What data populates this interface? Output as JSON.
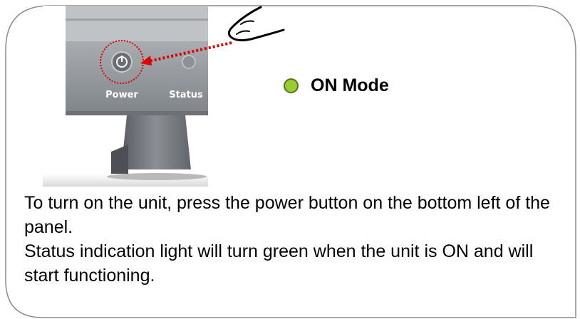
{
  "figure": {
    "power_label": "Power",
    "status_label": "Status",
    "power_icon": "power-icon",
    "hand_icon": "pointing-hand-icon"
  },
  "legend": {
    "label": "ON Mode",
    "dot_color": "#99cc33"
  },
  "body": {
    "paragraph1": "To turn on the unit, press the power button on the bottom left of the panel.",
    "paragraph2": "Status indication light will turn green when the unit is ON and will start functioning."
  },
  "colors": {
    "frame_border": "#8c8c8c",
    "arrow": "#e00000"
  }
}
